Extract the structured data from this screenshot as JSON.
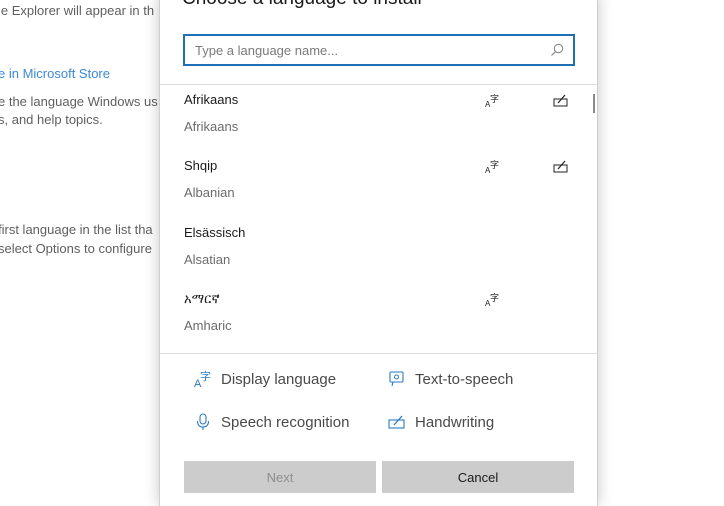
{
  "background_page": {
    "lines": [
      "le Explorer will appear in th",
      "e in Microsoft Store",
      "e the language Windows us",
      "s, and help topics.",
      "first language in the list tha",
      "select Options to configure"
    ]
  },
  "dialog": {
    "title": "Choose a language to install",
    "search": {
      "placeholder": "Type a language name...",
      "value": ""
    },
    "languages": [
      {
        "native": "Afrikaans",
        "english": "Afrikaans",
        "features": [
          "display-language",
          "handwriting"
        ]
      },
      {
        "native": "Shqip",
        "english": "Albanian",
        "features": [
          "display-language",
          "handwriting"
        ]
      },
      {
        "native": "Elsässisch",
        "english": "Alsatian",
        "features": []
      },
      {
        "native": "አማርኛ",
        "english": "Amharic",
        "features": [
          "display-language"
        ]
      }
    ],
    "legend": {
      "display_language": "Display language",
      "text_to_speech": "Text-to-speech",
      "speech_recognition": "Speech recognition",
      "handwriting": "Handwriting"
    },
    "buttons": {
      "next": "Next",
      "cancel": "Cancel",
      "next_enabled": false
    },
    "colors": {
      "accent": "#1f6fb5",
      "link": "#3c8ad6",
      "button_bg": "#cccccc"
    }
  }
}
